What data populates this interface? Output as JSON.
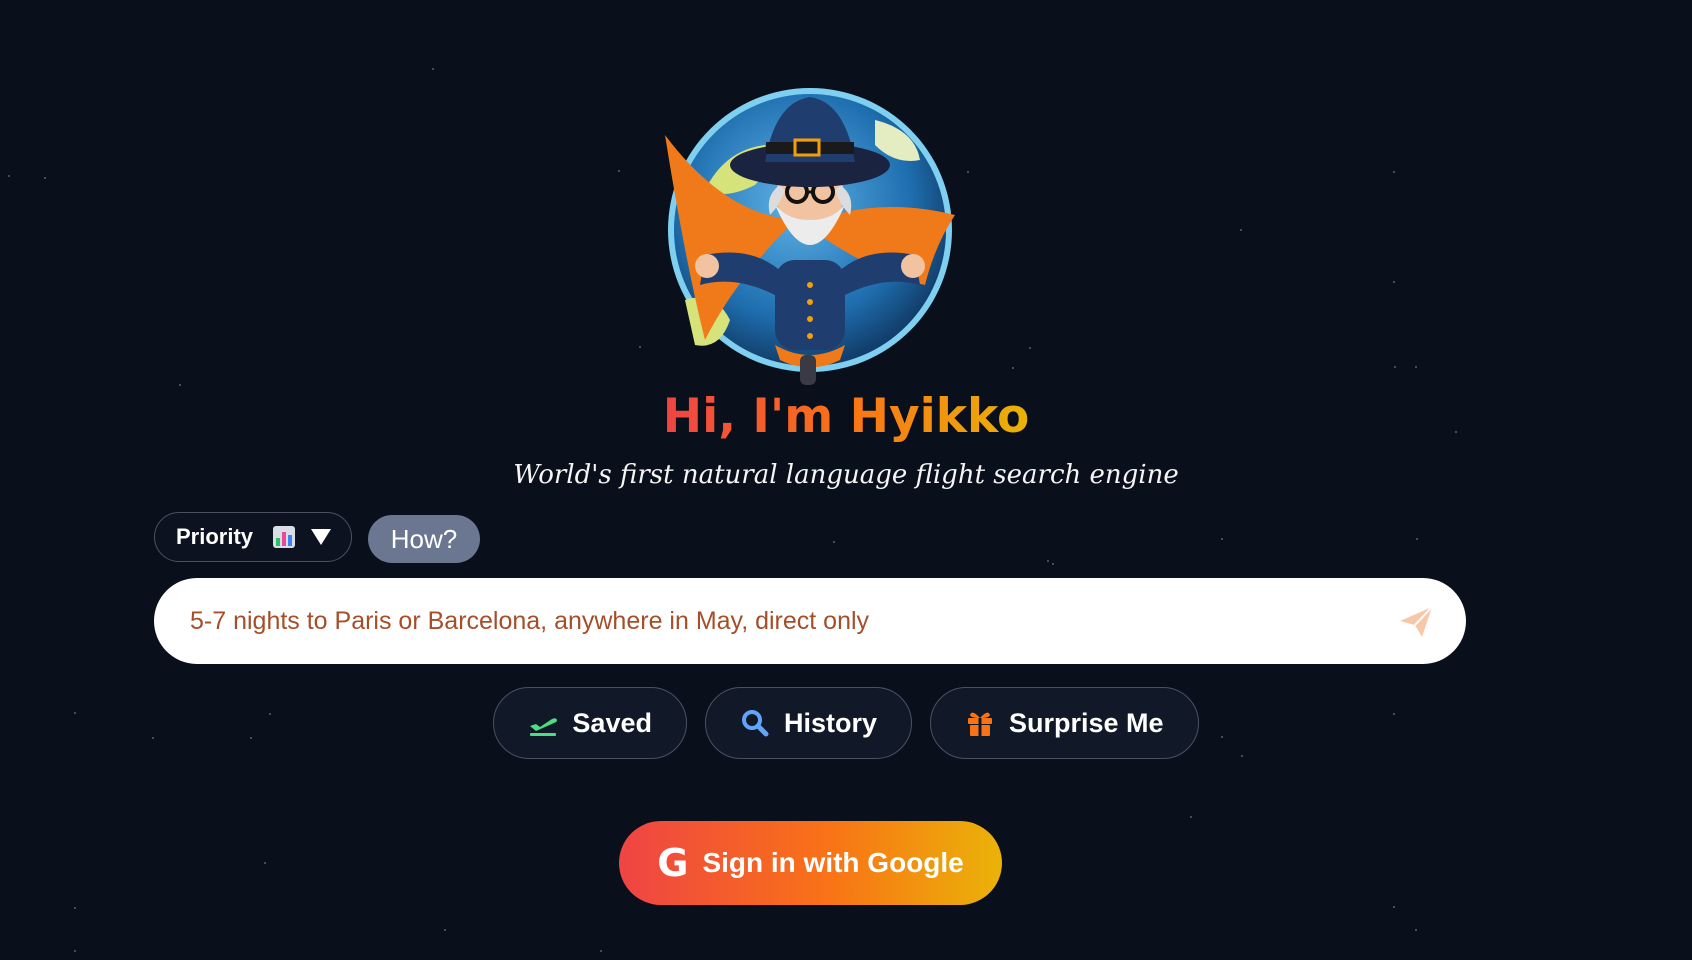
{
  "hero": {
    "title": "Hi, I'm Hyikko",
    "subtitle": "World's first natural language flight search engine"
  },
  "controls": {
    "priority_label": "Priority",
    "how_label": "How?"
  },
  "search": {
    "placeholder": "5-7 nights to Paris or Barcelona, anywhere in May, direct only",
    "value": ""
  },
  "actions": {
    "saved_label": "Saved",
    "history_label": "History",
    "surprise_label": "Surprise Me"
  },
  "auth": {
    "google_label": "Sign in with Google"
  },
  "icons": {
    "mascot": "wizard-globe-mascot",
    "priority": "bar-chart-icon",
    "caret": "caret-down-icon",
    "send": "paper-plane-icon",
    "saved": "plane-takeoff-icon",
    "history": "search-icon",
    "surprise": "gift-icon",
    "google": "google-g-icon"
  },
  "colors": {
    "background": "#0a0f1c",
    "accent_start": "#ef4444",
    "accent_mid": "#f97316",
    "accent_end": "#eab308",
    "placeholder": "#a0461f",
    "saved_icon": "#4ade80",
    "history_icon": "#60a5fa",
    "surprise_icon": "#f97316"
  }
}
